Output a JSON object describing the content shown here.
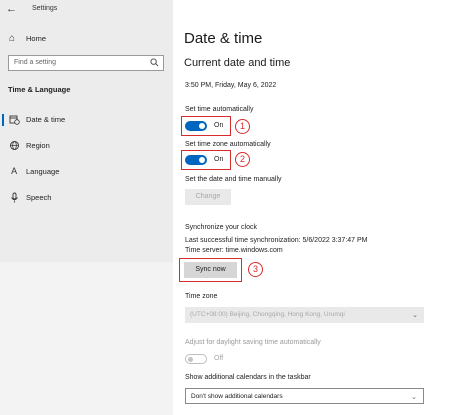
{
  "window": {
    "title": "Settings"
  },
  "sidebar": {
    "home_label": "Home",
    "search_placeholder": "Find a setting",
    "section_title": "Time & Language",
    "items": [
      {
        "label": "Date & time",
        "icon": "calendar-clock-icon",
        "active": true
      },
      {
        "label": "Region",
        "icon": "globe-icon",
        "active": false
      },
      {
        "label": "Language",
        "icon": "language-icon",
        "active": false
      },
      {
        "label": "Speech",
        "icon": "microphone-icon",
        "active": false
      }
    ]
  },
  "main": {
    "page_title": "Date & time",
    "section_title": "Current date and time",
    "current_datetime": "3:50 PM, Friday, May 6, 2022",
    "set_time_auto": {
      "label": "Set time automatically",
      "state": "On"
    },
    "set_timezone_auto": {
      "label": "Set time zone automatically",
      "state": "On"
    },
    "manual": {
      "label": "Set the date and time manually",
      "button": "Change"
    },
    "sync": {
      "title": "Synchronize your clock",
      "last_sync": "Last successful time synchronization: 5/6/2022 3:37:47 PM",
      "server": "Time server: time.windows.com",
      "button": "Sync now"
    },
    "timezone": {
      "label": "Time zone",
      "value": "(UTC+08:00) Beijing, Chongqing, Hong Kong, Urumqi"
    },
    "dst": {
      "label": "Adjust for daylight saving time automatically",
      "state": "Off"
    },
    "calendars": {
      "label": "Show additional calendars in the taskbar",
      "value": "Don't show additional calendars"
    }
  },
  "annotations": {
    "markers": [
      "1",
      "2",
      "3"
    ],
    "color": "#d62c2c"
  },
  "colors": {
    "accent": "#0067c0",
    "sidebar_bg": "#ececec"
  }
}
